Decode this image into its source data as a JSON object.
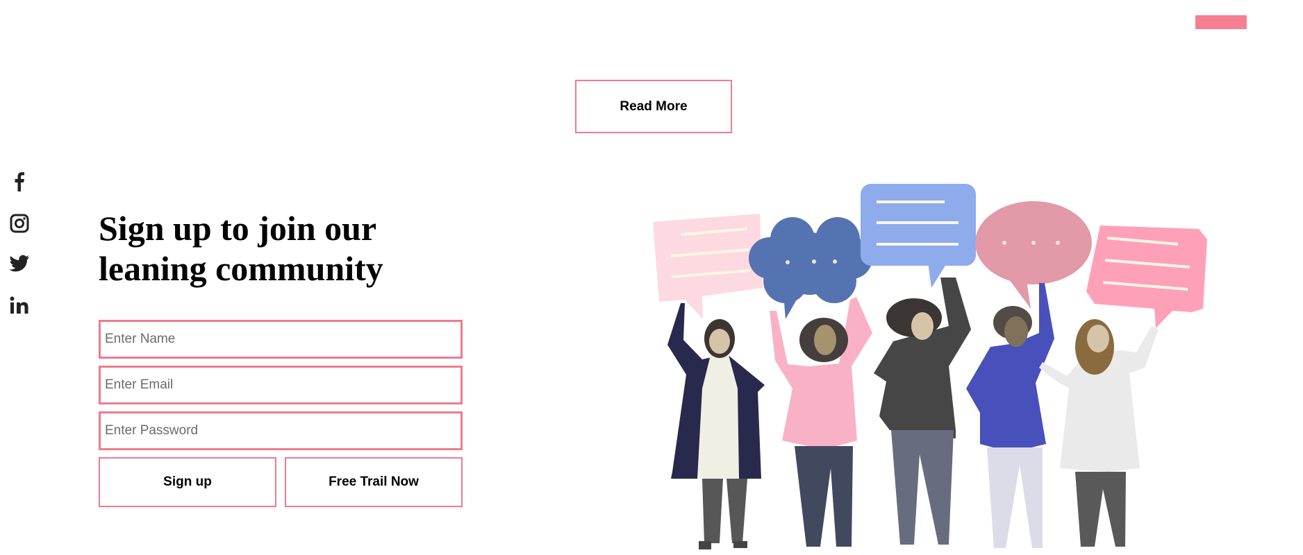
{
  "header": {
    "accent_color": "#f77f93"
  },
  "hero": {
    "read_more_label": "Read More"
  },
  "social": [
    {
      "icon": "facebook-icon"
    },
    {
      "icon": "instagram-icon"
    },
    {
      "icon": "twitter-icon"
    },
    {
      "icon": "linkedin-icon"
    }
  ],
  "signup": {
    "title_line1": "Sign up to join our",
    "title_line2": "leaning community",
    "name_placeholder": "Enter Name",
    "email_placeholder": "Enter Email",
    "password_placeholder": "Enter Password",
    "signup_label": "Sign up",
    "trial_label": "Free Trail Now"
  }
}
